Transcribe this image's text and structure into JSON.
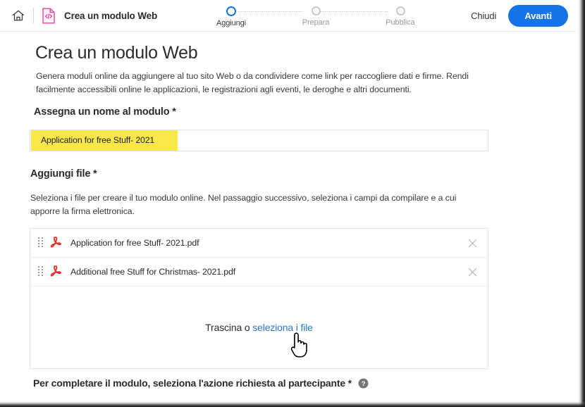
{
  "header": {
    "home_icon": "home-icon",
    "app_icon": "web-form-code-icon",
    "title": "Crea un modulo Web",
    "close_label": "Chiudi",
    "next_label": "Avanti",
    "accent_color": "#1473e6",
    "app_icon_color": "#e1439a",
    "steps": [
      {
        "label": "Aggiungi",
        "active": true
      },
      {
        "label": "Prepara",
        "active": false
      },
      {
        "label": "Pubblica",
        "active": false
      }
    ]
  },
  "main": {
    "page_title": "Crea un modulo Web",
    "page_description": "Genera moduli online da aggiungere al tuo sito Web o da condividere come link per raccogliere dati e firme. Rendi facilmente accessibili online le applicazioni, le registrazioni agli eventi, le deroghe e altri documenti.",
    "name_section": {
      "label": "Assegna un nome al modulo *",
      "value": "Application for free Stuff- 2021",
      "placeholder": "",
      "highlight_color": "#fae74a"
    },
    "files_section": {
      "label": "Aggiungi file *",
      "description": "Seleziona i file per creare il tuo modulo online. Nel passaggio successivo, seleziona i campi da compilare e a cui apporre la firma elettronica.",
      "files": [
        {
          "name": "Application for free Stuff- 2021.pdf",
          "icon": "pdf-icon",
          "remove_icon": "close-icon"
        },
        {
          "name": "Additional free Stuff for Christmas- 2021.pdf",
          "icon": "pdf-icon",
          "remove_icon": "close-icon"
        }
      ],
      "dropzone_text": "Trascina o ",
      "dropzone_link": "seleziona i file",
      "pdf_icon_color": "#e02d25"
    },
    "footer_section": {
      "label": "Per completare il modulo, seleziona l'azione richiesta al partecipante *",
      "help_icon": "help-circle-icon"
    }
  }
}
